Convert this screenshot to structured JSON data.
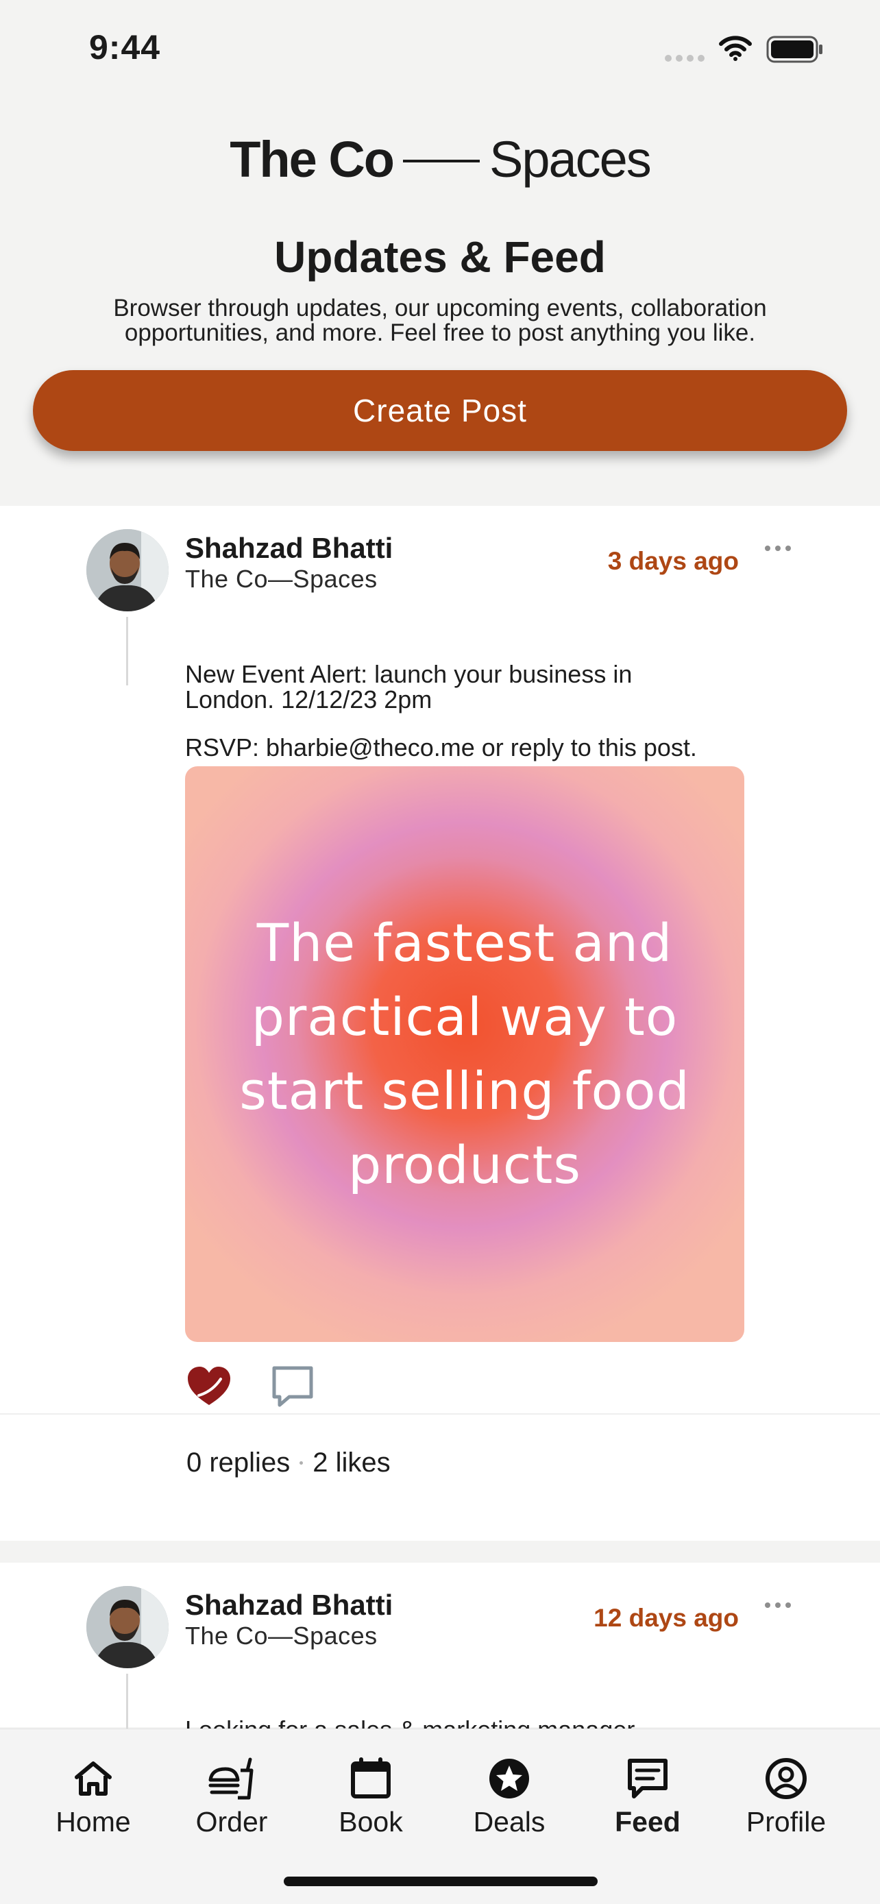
{
  "status_bar": {
    "time": "9:44"
  },
  "header": {
    "brand_bold": "The Co",
    "brand_light": "Spaces",
    "title": "Updates & Feed",
    "subtitle": "Browser through updates, our upcoming events, collaboration opportunities, and more. Feel free to post anything you like.",
    "create_post_label": "Create Post"
  },
  "posts": [
    {
      "author": "Shahzad Bhatti",
      "org": "The Co—Spaces",
      "time": "3 days ago",
      "body_line1": "New Event Alert: launch your business in London. 12/12/23 2pm",
      "body_line2": "RSVP: bharbie@theco.me or reply to this post.",
      "image_text": "The fastest and practical way to start selling food products",
      "replies": "0 replies",
      "likes": "2 likes",
      "liked": true
    },
    {
      "author": "Shahzad Bhatti",
      "org": "The Co—Spaces",
      "time": "12 days ago",
      "body_line1": "Looking for a sales & marketing manager"
    }
  ],
  "nav": {
    "items": [
      {
        "label": "Home",
        "icon": "home-icon"
      },
      {
        "label": "Order",
        "icon": "food-icon"
      },
      {
        "label": "Book",
        "icon": "calendar-icon"
      },
      {
        "label": "Deals",
        "icon": "star-icon"
      },
      {
        "label": "Feed",
        "icon": "message-icon"
      },
      {
        "label": "Profile",
        "icon": "user-circle-icon"
      }
    ],
    "active": "Feed"
  },
  "colors": {
    "accent": "#ae4714",
    "like": "#8e1a1a",
    "background": "#f3f3f2"
  }
}
